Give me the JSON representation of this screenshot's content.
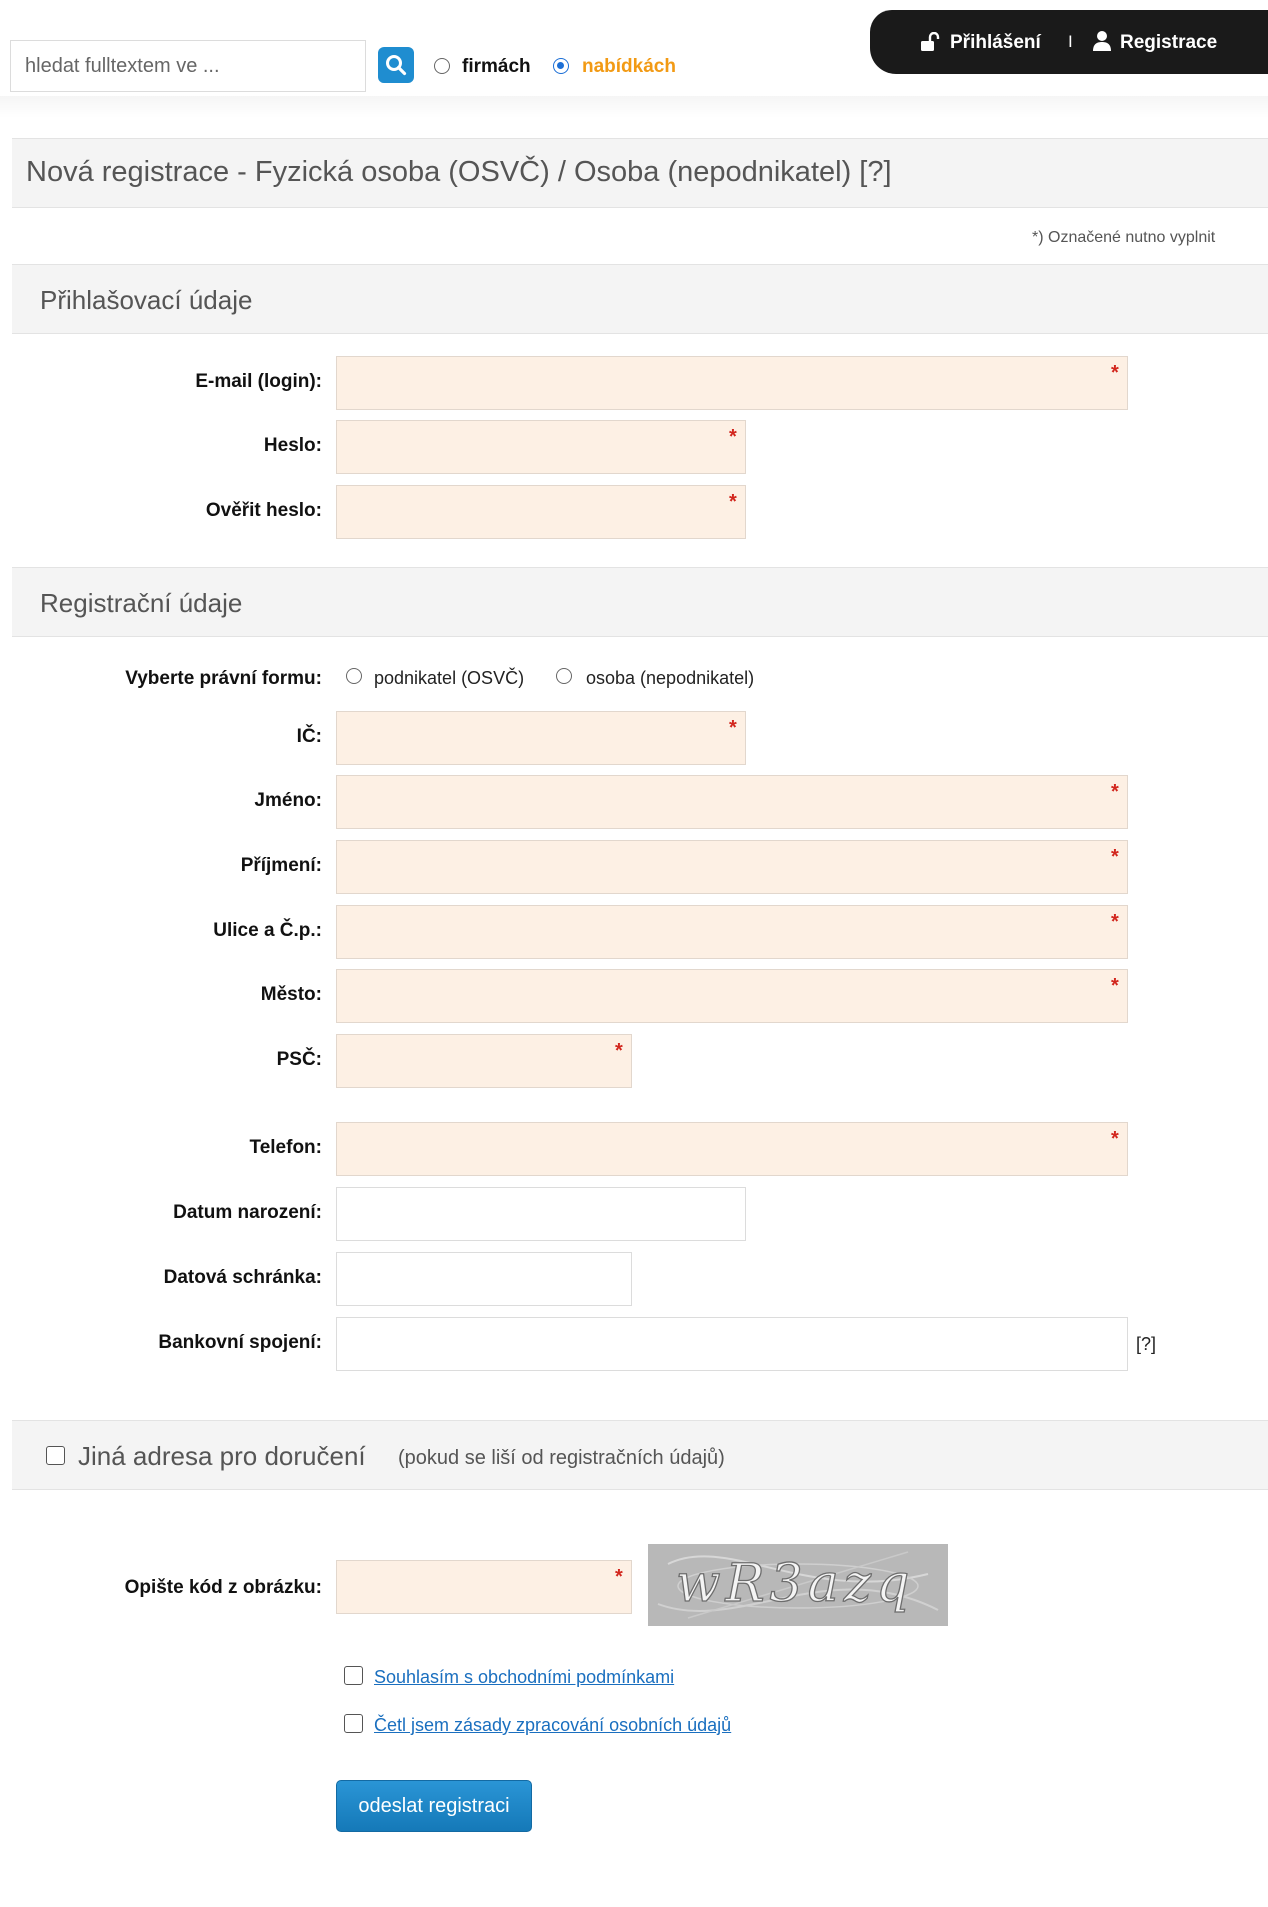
{
  "search": {
    "placeholder": "hledat fulltextem ve ...",
    "options": [
      {
        "label": "firmách",
        "selected": false
      },
      {
        "label": "nabídkách",
        "selected": true
      }
    ]
  },
  "auth": {
    "login_label": "Přihlášení",
    "separator": "I",
    "register_label": "Registrace"
  },
  "page": {
    "title": "Nová registrace - Fyzická osoba (OSVČ) / Osoba (nepodnikatel) [?]",
    "required_note": "*) Označené nutno vyplnit"
  },
  "sections": {
    "login": "Přihlašovací údaje",
    "registration": "Registrační údaje",
    "alt_address": "Jiná adresa pro doručení",
    "alt_address_note": "(pokud se liší od registračních údajů)"
  },
  "fields": {
    "email": "E-mail (login):",
    "password": "Heslo:",
    "password_confirm": "Ověřit heslo:",
    "legal_form": "Vyberte právní formu:",
    "legal_form_options": [
      "podnikatel (OSVČ)",
      "osoba (nepodnikatel)"
    ],
    "ic": "IČ:",
    "first_name": "Jméno:",
    "last_name": "Příjmení:",
    "street": "Ulice a Č.p.:",
    "city": "Město:",
    "zip": "PSČ:",
    "phone": "Telefon:",
    "birth_date": "Datum narození:",
    "data_box": "Datová schránka:",
    "bank": "Bankovní spojení:",
    "bank_help": "[?]",
    "captcha": "Opište kód z obrázku:",
    "captcha_text": "wR3azq"
  },
  "required_mark": "*",
  "agreements": {
    "terms": "Souhlasím s obchodními podmínkami",
    "privacy": "Četl jsem zásady zpracování osobních údajů"
  },
  "submit_label": "odeslat registraci",
  "colors": {
    "accent": "#1f8dd0",
    "selected_option": "#f29a14",
    "required_field_bg": "#fdf0e4",
    "required_mark": "#d2261d",
    "link": "#1a6fbf"
  }
}
